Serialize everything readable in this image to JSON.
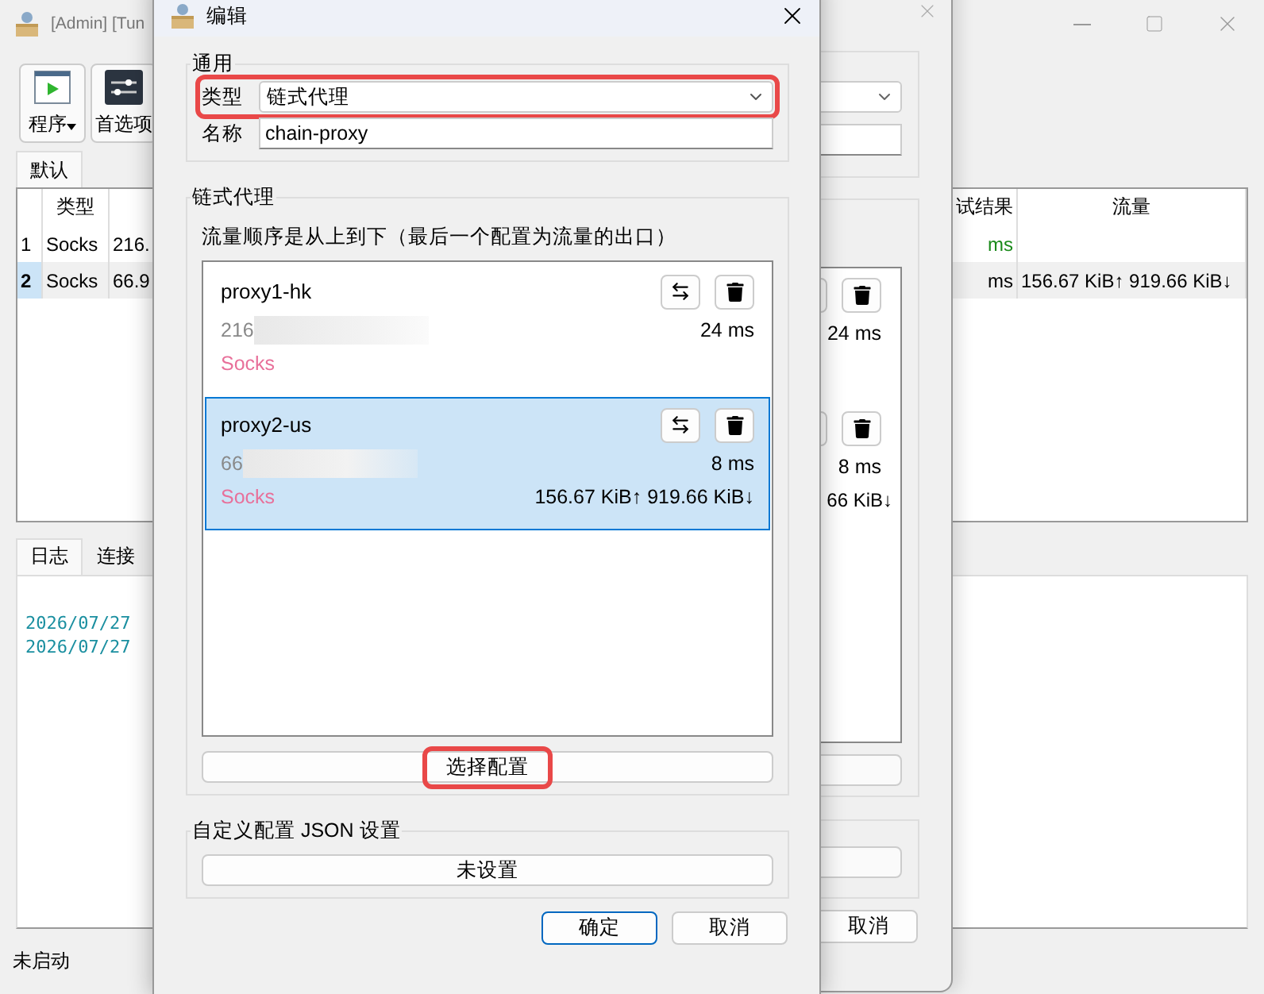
{
  "main_window": {
    "title": "[Admin] [Tun",
    "toolbar": [
      {
        "label": "程序",
        "kind": "menu"
      },
      {
        "label": "首选项",
        "kind": "plain"
      }
    ],
    "profile_tabs": [
      {
        "label": "默认",
        "selected": true
      }
    ],
    "table": {
      "columns": [
        "类型",
        "试结果",
        "流量"
      ],
      "rows": [
        {
          "index": "1",
          "type": "Socks",
          "column_3": "216.",
          "test": "ms",
          "color": "#1a8a1a",
          "selected": false
        },
        {
          "index": "2",
          "type": "Socks",
          "column_3": "66.9",
          "test": "ms",
          "color": "#000000",
          "traffic": "156.67 KiB↑ 919.66 KiB↓",
          "selected": true
        }
      ]
    },
    "log_tabs": [
      {
        "label": "日志",
        "selected": true
      },
      {
        "label": "连接",
        "selected": false
      }
    ],
    "log_lines": [
      "2026/07/27",
      "2026/07/27"
    ],
    "status": "未启动"
  },
  "back_dialog": {
    "latency": [
      "24 ms",
      "8 ms"
    ],
    "traffic_tail": "66 KiB↓",
    "cancel": "取消"
  },
  "dialog": {
    "title": "编辑",
    "general": {
      "title": "通用",
      "type_label": "类型",
      "type_value": "链式代理",
      "type_highlighted": true,
      "name_label": "名称",
      "name_value": "chain-proxy"
    },
    "chain": {
      "title": "链式代理",
      "hint": "流量顺序是从上到下（最后一个配置为流量的出口）",
      "items": [
        {
          "name": "proxy1-hk",
          "address": "216",
          "latency": "24 ms",
          "protocol": "Socks",
          "selected": false
        },
        {
          "name": "proxy2-us",
          "address": "66",
          "latency": "8 ms",
          "protocol": "Socks",
          "traffic": "156.67 KiB↑ 919.66 KiB↓",
          "selected": true
        }
      ],
      "select_button": "选择配置",
      "select_highlighted": true
    },
    "custom": {
      "title": "自定义配置 JSON 设置",
      "button": "未设置"
    },
    "buttons": [
      {
        "label": "确定",
        "primary": true
      },
      {
        "label": "取消",
        "primary": false
      }
    ]
  }
}
